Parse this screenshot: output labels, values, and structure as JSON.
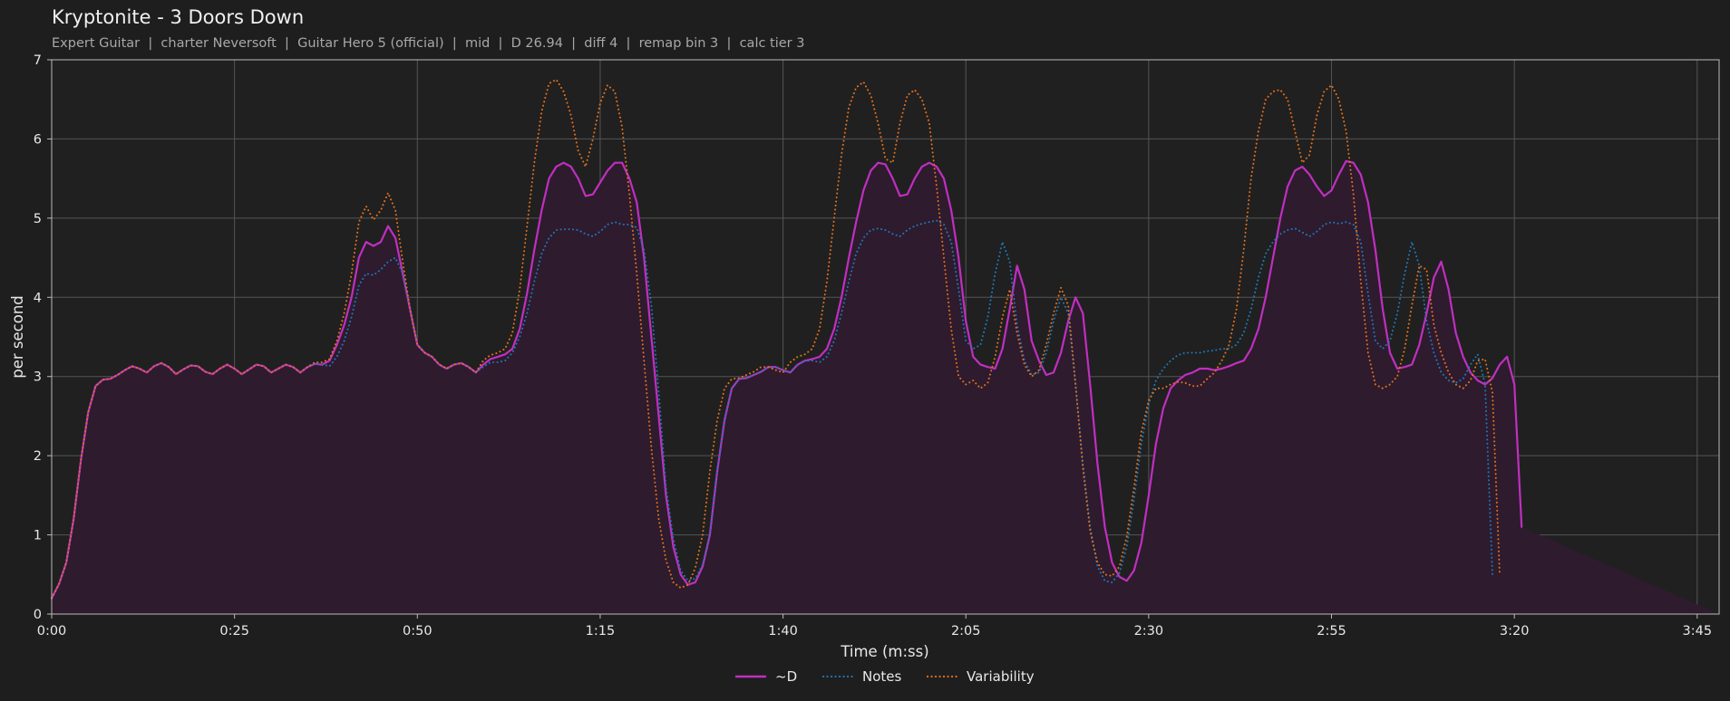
{
  "header": {
    "title": "Kryptonite - 3 Doors Down",
    "subtitle": "Expert Guitar  |  charter Neversoft  |  Guitar Hero 5 (official)  |  mid  |  D 26.94  |  diff 4  |  remap bin 3  |  calc tier 3"
  },
  "colors": {
    "background": "#1e1e1e",
    "plot_background": "#202020",
    "grid": "#555555",
    "axis": "#bbbbbb",
    "d_line": "#c02fc0",
    "d_fill": "#2e1b2e",
    "notes_line": "#1f77b4",
    "variability_line": "#e0701e"
  },
  "chart_data": {
    "type": "line",
    "xlabel": "Time (m:ss)",
    "ylabel": "per second",
    "xlim": [
      0,
      228
    ],
    "ylim": [
      0,
      7
    ],
    "grid": true,
    "legend_position": "bottom-center",
    "x_ticks": [
      {
        "value": 0,
        "label": "0:00"
      },
      {
        "value": 25,
        "label": "0:25"
      },
      {
        "value": 50,
        "label": "0:50"
      },
      {
        "value": 75,
        "label": "1:15"
      },
      {
        "value": 100,
        "label": "1:40"
      },
      {
        "value": 125,
        "label": "2:05"
      },
      {
        "value": 150,
        "label": "2:30"
      },
      {
        "value": 175,
        "label": "2:55"
      },
      {
        "value": 200,
        "label": "3:20"
      },
      {
        "value": 225,
        "label": "3:45"
      }
    ],
    "y_ticks": [
      0,
      1,
      2,
      3,
      4,
      5,
      6,
      7
    ],
    "x": [
      0,
      1,
      2,
      3,
      4,
      5,
      6,
      7,
      8,
      9,
      10,
      11,
      12,
      13,
      14,
      15,
      16,
      17,
      18,
      19,
      20,
      21,
      22,
      23,
      24,
      25,
      26,
      27,
      28,
      29,
      30,
      31,
      32,
      33,
      34,
      35,
      36,
      37,
      38,
      39,
      40,
      41,
      42,
      43,
      44,
      45,
      46,
      47,
      48,
      49,
      50,
      51,
      52,
      53,
      54,
      55,
      56,
      57,
      58,
      59,
      60,
      61,
      62,
      63,
      64,
      65,
      66,
      67,
      68,
      69,
      70,
      71,
      72,
      73,
      74,
      75,
      76,
      77,
      78,
      79,
      80,
      81,
      82,
      83,
      84,
      85,
      86,
      87,
      88,
      89,
      90,
      91,
      92,
      93,
      94,
      95,
      96,
      97,
      98,
      99,
      100,
      101,
      102,
      103,
      104,
      105,
      106,
      107,
      108,
      109,
      110,
      111,
      112,
      113,
      114,
      115,
      116,
      117,
      118,
      119,
      120,
      121,
      122,
      123,
      124,
      125,
      126,
      127,
      128,
      129,
      130,
      131,
      132,
      133,
      134,
      135,
      136,
      137,
      138,
      139,
      140,
      141,
      142,
      143,
      144,
      145,
      146,
      147,
      148,
      149,
      150,
      151,
      152,
      153,
      154,
      155,
      156,
      157,
      158,
      159,
      160,
      161,
      162,
      163,
      164,
      165,
      166,
      167,
      168,
      169,
      170,
      171,
      172,
      173,
      174,
      175,
      176,
      177,
      178,
      179,
      180,
      181,
      182,
      183,
      184,
      185,
      186,
      187,
      188,
      189,
      190,
      191,
      192,
      193,
      194,
      195,
      196,
      197,
      198,
      199,
      200,
      201,
      202,
      203,
      204,
      205,
      206,
      207,
      208,
      209,
      210,
      211,
      212,
      213,
      214,
      215,
      216,
      217,
      218,
      219,
      220,
      221,
      222,
      223,
      224,
      225,
      226,
      227,
      228
    ],
    "series": [
      {
        "name": "~D",
        "style": "solid",
        "color": "#c02fc0",
        "fill": true,
        "values": [
          0.2,
          0.38,
          0.65,
          1.2,
          1.95,
          2.55,
          2.88,
          2.96,
          2.97,
          3.02,
          3.08,
          3.13,
          3.1,
          3.05,
          3.13,
          3.17,
          3.12,
          3.03,
          3.09,
          3.14,
          3.13,
          3.06,
          3.03,
          3.1,
          3.15,
          3.1,
          3.03,
          3.09,
          3.15,
          3.13,
          3.05,
          3.1,
          3.15,
          3.12,
          3.05,
          3.12,
          3.16,
          3.15,
          3.2,
          3.4,
          3.65,
          4.0,
          4.5,
          4.7,
          4.65,
          4.7,
          4.9,
          4.75,
          4.3,
          3.85,
          3.4,
          3.3,
          3.25,
          3.15,
          3.1,
          3.15,
          3.17,
          3.12,
          3.05,
          3.15,
          3.22,
          3.25,
          3.28,
          3.35,
          3.6,
          4.05,
          4.6,
          5.1,
          5.5,
          5.65,
          5.7,
          5.65,
          5.5,
          5.28,
          5.3,
          5.45,
          5.6,
          5.7,
          5.7,
          5.5,
          5.2,
          4.5,
          3.5,
          2.5,
          1.5,
          0.85,
          0.5,
          0.37,
          0.4,
          0.6,
          1.0,
          1.8,
          2.45,
          2.85,
          2.97,
          2.98,
          3.02,
          3.06,
          3.12,
          3.12,
          3.08,
          3.05,
          3.15,
          3.2,
          3.22,
          3.25,
          3.35,
          3.6,
          4.0,
          4.5,
          4.95,
          5.35,
          5.6,
          5.7,
          5.68,
          5.5,
          5.28,
          5.3,
          5.5,
          5.65,
          5.7,
          5.65,
          5.5,
          5.1,
          4.5,
          3.7,
          3.25,
          3.15,
          3.12,
          3.1,
          3.35,
          3.85,
          4.4,
          4.1,
          3.45,
          3.2,
          3.02,
          3.05,
          3.3,
          3.7,
          4.0,
          3.8,
          2.9,
          1.9,
          1.1,
          0.65,
          0.47,
          0.42,
          0.55,
          0.9,
          1.5,
          2.15,
          2.6,
          2.85,
          2.95,
          3.02,
          3.05,
          3.1,
          3.1,
          3.08,
          3.1,
          3.13,
          3.17,
          3.2,
          3.35,
          3.6,
          4.0,
          4.5,
          5.0,
          5.4,
          5.6,
          5.65,
          5.55,
          5.4,
          5.28,
          5.35,
          5.55,
          5.72,
          5.7,
          5.55,
          5.2,
          4.6,
          3.85,
          3.3,
          3.1,
          3.12,
          3.15,
          3.4,
          3.8,
          4.25,
          4.45,
          4.1,
          3.55,
          3.25,
          3.05,
          2.95,
          2.9,
          2.98,
          3.15,
          3.25,
          2.9,
          1.1
        ]
      },
      {
        "name": "Notes",
        "style": "dotted",
        "color": "#1f77b4",
        "fill": false,
        "values": [
          0.2,
          0.38,
          0.65,
          1.2,
          1.95,
          2.55,
          2.88,
          2.96,
          2.97,
          3.02,
          3.08,
          3.13,
          3.1,
          3.05,
          3.13,
          3.17,
          3.12,
          3.03,
          3.09,
          3.14,
          3.13,
          3.06,
          3.03,
          3.1,
          3.15,
          3.1,
          3.03,
          3.09,
          3.15,
          3.13,
          3.05,
          3.1,
          3.15,
          3.12,
          3.05,
          3.12,
          3.16,
          3.15,
          3.13,
          3.25,
          3.45,
          3.75,
          4.15,
          4.3,
          4.28,
          4.35,
          4.45,
          4.5,
          4.3,
          3.85,
          3.4,
          3.3,
          3.25,
          3.15,
          3.1,
          3.15,
          3.17,
          3.12,
          3.05,
          3.12,
          3.18,
          3.18,
          3.2,
          3.3,
          3.5,
          3.8,
          4.2,
          4.55,
          4.75,
          4.85,
          4.86,
          4.86,
          4.85,
          4.8,
          4.77,
          4.83,
          4.92,
          4.95,
          4.92,
          4.92,
          4.88,
          4.6,
          3.9,
          2.8,
          1.6,
          0.95,
          0.55,
          0.42,
          0.45,
          0.62,
          1.0,
          1.8,
          2.45,
          2.85,
          2.97,
          2.98,
          3.02,
          3.06,
          3.12,
          3.12,
          3.08,
          3.05,
          3.15,
          3.2,
          3.2,
          3.18,
          3.25,
          3.45,
          3.8,
          4.2,
          4.55,
          4.75,
          4.85,
          4.87,
          4.85,
          4.8,
          4.77,
          4.85,
          4.9,
          4.93,
          4.95,
          4.97,
          4.92,
          4.7,
          4.1,
          3.45,
          3.35,
          3.4,
          3.75,
          4.3,
          4.7,
          4.45,
          3.65,
          3.2,
          3.02,
          3.05,
          3.3,
          3.7,
          4.0,
          3.8,
          2.9,
          1.9,
          1.1,
          0.6,
          0.42,
          0.4,
          0.52,
          0.85,
          1.45,
          2.15,
          2.65,
          2.95,
          3.1,
          3.2,
          3.27,
          3.3,
          3.3,
          3.3,
          3.32,
          3.33,
          3.35,
          3.35,
          3.4,
          3.55,
          3.85,
          4.25,
          4.55,
          4.7,
          4.8,
          4.85,
          4.87,
          4.82,
          4.77,
          4.83,
          4.92,
          4.95,
          4.93,
          4.95,
          4.92,
          4.7,
          4.05,
          3.45,
          3.35,
          3.45,
          3.8,
          4.3,
          4.7,
          4.4,
          3.7,
          3.3,
          3.05,
          2.95,
          2.92,
          2.97,
          3.15,
          3.28,
          2.9,
          0.5
        ]
      },
      {
        "name": "Variability",
        "style": "dotted",
        "color": "#e0701e",
        "fill": false,
        "values": [
          0.2,
          0.38,
          0.65,
          1.2,
          1.95,
          2.55,
          2.88,
          2.96,
          2.97,
          3.02,
          3.08,
          3.13,
          3.1,
          3.05,
          3.13,
          3.17,
          3.12,
          3.03,
          3.09,
          3.14,
          3.13,
          3.06,
          3.03,
          3.1,
          3.15,
          3.1,
          3.03,
          3.09,
          3.15,
          3.13,
          3.05,
          3.1,
          3.15,
          3.12,
          3.05,
          3.12,
          3.18,
          3.18,
          3.22,
          3.45,
          3.8,
          4.3,
          4.95,
          5.15,
          4.98,
          5.1,
          5.32,
          5.1,
          4.45,
          3.85,
          3.4,
          3.3,
          3.25,
          3.15,
          3.1,
          3.15,
          3.17,
          3.12,
          3.05,
          3.2,
          3.27,
          3.3,
          3.35,
          3.55,
          4.1,
          4.9,
          5.7,
          6.35,
          6.7,
          6.75,
          6.6,
          6.3,
          5.85,
          5.65,
          6.0,
          6.45,
          6.68,
          6.6,
          6.15,
          5.3,
          4.3,
          3.2,
          2.1,
          1.2,
          0.68,
          0.4,
          0.33,
          0.37,
          0.58,
          1.0,
          1.8,
          2.45,
          2.85,
          2.97,
          2.98,
          3.02,
          3.06,
          3.12,
          3.12,
          3.08,
          3.05,
          3.18,
          3.25,
          3.28,
          3.35,
          3.6,
          4.2,
          5.0,
          5.8,
          6.4,
          6.65,
          6.72,
          6.55,
          6.2,
          5.75,
          5.7,
          6.2,
          6.55,
          6.62,
          6.5,
          6.2,
          5.4,
          4.5,
          3.6,
          3.0,
          2.9,
          2.95,
          2.85,
          2.92,
          3.25,
          3.75,
          4.1,
          3.55,
          3.15,
          3.0,
          3.08,
          3.4,
          3.8,
          4.12,
          3.9,
          2.9,
          1.85,
          1.05,
          0.65,
          0.5,
          0.48,
          0.6,
          0.98,
          1.6,
          2.3,
          2.7,
          2.85,
          2.85,
          2.9,
          2.93,
          2.92,
          2.88,
          2.88,
          2.97,
          3.05,
          3.2,
          3.4,
          3.85,
          4.6,
          5.5,
          6.1,
          6.5,
          6.6,
          6.62,
          6.5,
          6.1,
          5.7,
          5.8,
          6.3,
          6.6,
          6.68,
          6.5,
          6.1,
          5.3,
          4.2,
          3.3,
          2.9,
          2.85,
          2.9,
          3.0,
          3.35,
          3.9,
          4.4,
          4.35,
          3.65,
          3.3,
          3.05,
          2.9,
          2.85,
          2.95,
          3.2,
          3.22,
          2.8,
          0.5
        ]
      }
    ]
  }
}
